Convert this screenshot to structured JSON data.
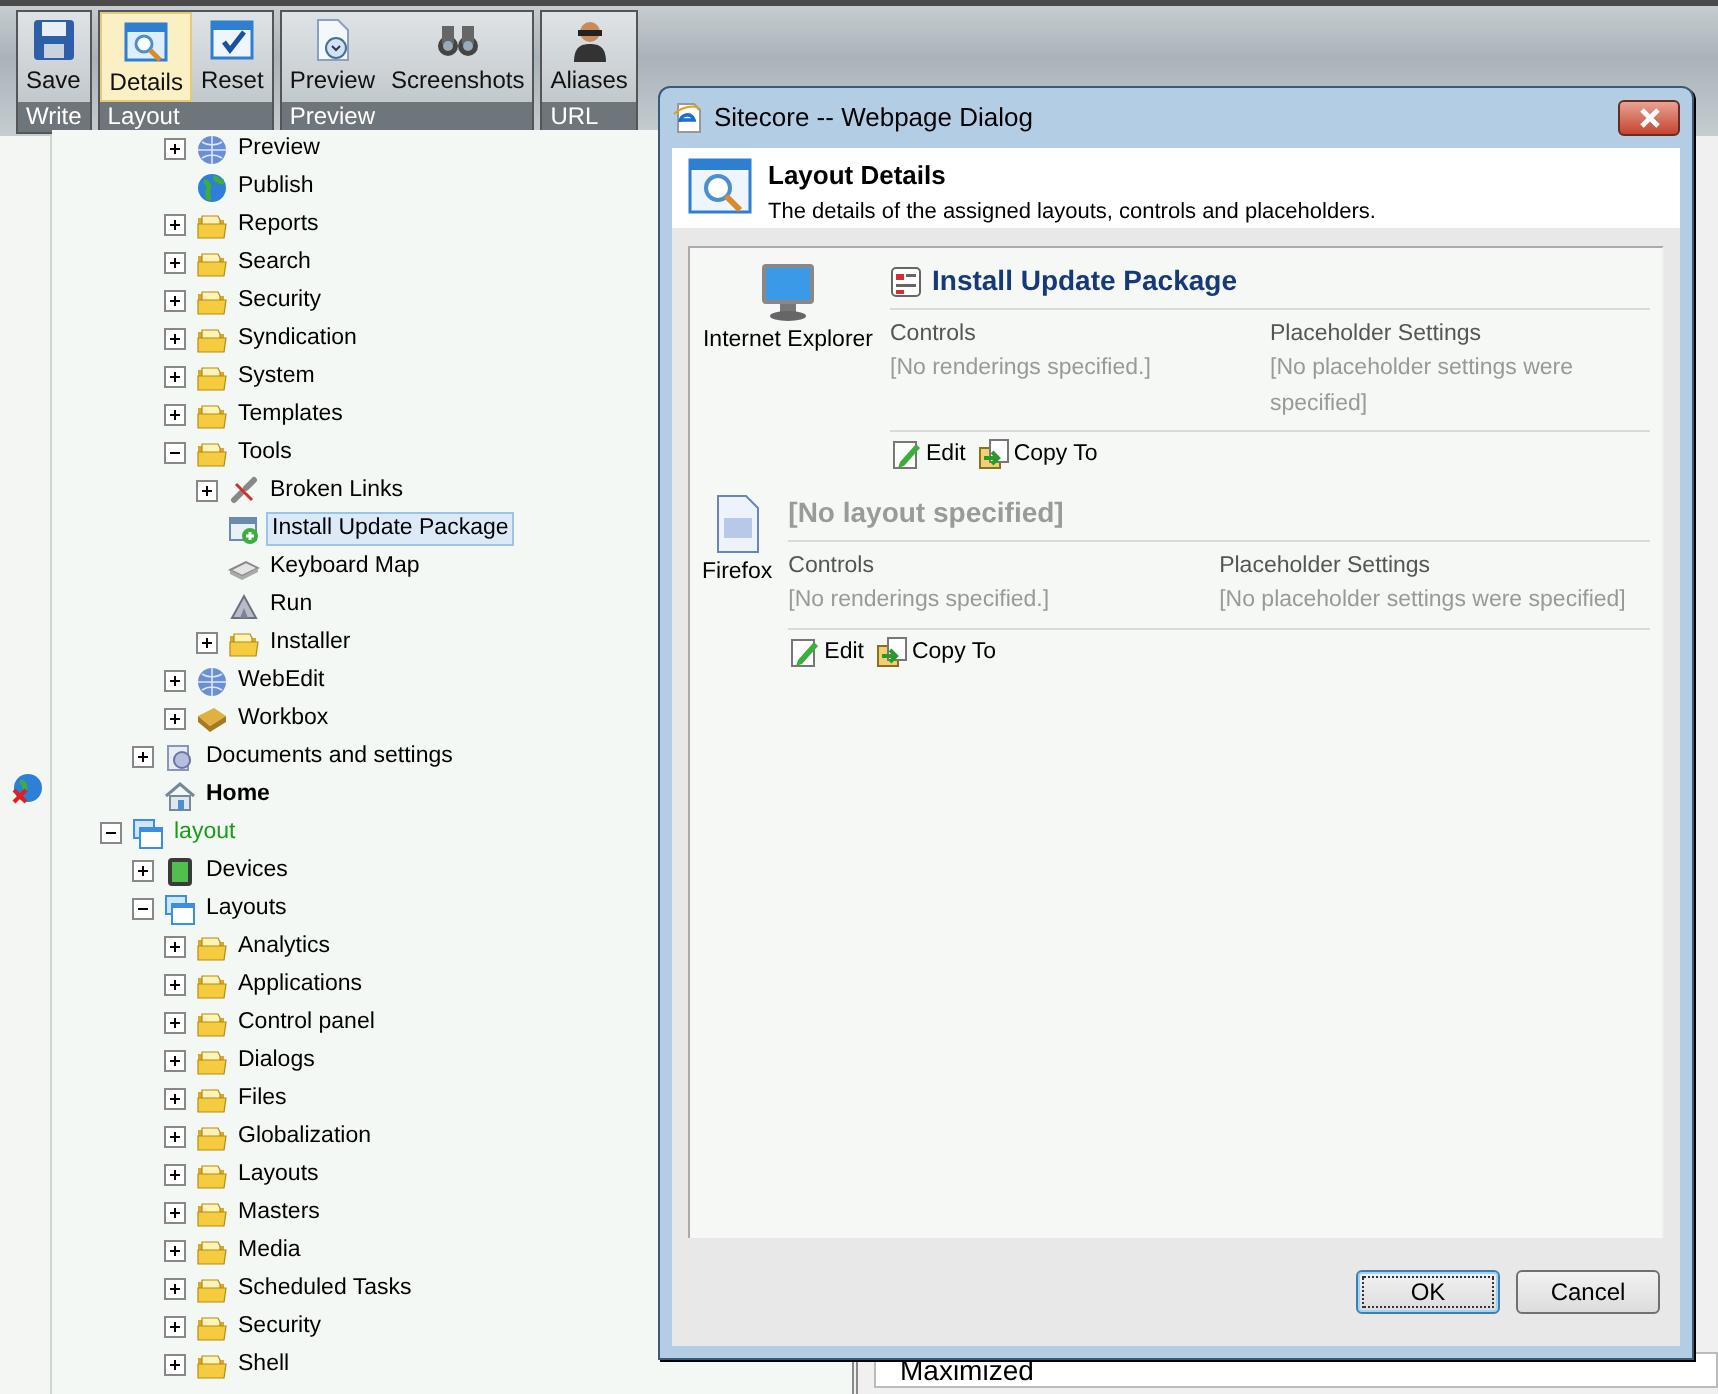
{
  "ribbon": [
    {
      "label": "Write",
      "buttons": [
        {
          "label": "Save",
          "kind": "save",
          "selected": false
        }
      ]
    },
    {
      "label": "Layout",
      "buttons": [
        {
          "label": "Details",
          "kind": "details",
          "selected": true
        },
        {
          "label": "Reset",
          "kind": "reset",
          "selected": false
        }
      ]
    },
    {
      "label": "Preview",
      "buttons": [
        {
          "label": "Preview",
          "kind": "preview",
          "selected": false
        },
        {
          "label": "Screenshots",
          "kind": "binoculars",
          "selected": false
        }
      ]
    },
    {
      "label": "URL",
      "buttons": [
        {
          "label": "Aliases",
          "kind": "person",
          "selected": false
        }
      ]
    }
  ],
  "tree": [
    {
      "children": [
        {
          "children": [
            {
              "label": "Preview",
              "kind": "webglobe",
              "expanded": false,
              "selected": false
            },
            {
              "label": "Publish",
              "kind": "globe",
              "selected": false
            },
            {
              "label": "Reports",
              "kind": "folder",
              "expanded": false,
              "selected": false
            },
            {
              "label": "Search",
              "kind": "folder",
              "expanded": false,
              "selected": false
            },
            {
              "label": "Security",
              "kind": "folder",
              "expanded": false,
              "selected": false
            },
            {
              "label": "Syndication",
              "kind": "folder",
              "expanded": false,
              "selected": false
            },
            {
              "label": "System",
              "kind": "folder",
              "expanded": false,
              "selected": false
            },
            {
              "label": "Templates",
              "kind": "folder",
              "expanded": false,
              "selected": false
            },
            {
              "label": "Tools",
              "kind": "folder",
              "expanded": true,
              "selected": false,
              "children": [
                {
                  "label": "Broken Links",
                  "kind": "brokenlink",
                  "expanded": false,
                  "selected": false
                },
                {
                  "label": "Install Update Package",
                  "kind": "package",
                  "selected": true
                },
                {
                  "label": "Keyboard Map",
                  "kind": "keyboard",
                  "selected": false
                },
                {
                  "label": "Run",
                  "kind": "run",
                  "selected": false
                },
                {
                  "label": "Installer",
                  "kind": "folder",
                  "expanded": false,
                  "selected": false
                }
              ]
            },
            {
              "label": "WebEdit",
              "kind": "webglobe",
              "expanded": false,
              "selected": false
            },
            {
              "label": "Workbox",
              "kind": "workbox",
              "expanded": false,
              "selected": false
            }
          ]
        },
        {
          "label": "Documents and settings",
          "kind": "docs",
          "expanded": false,
          "selected": false
        },
        {
          "label": "Home",
          "kind": "home",
          "selected": false,
          "bold": true,
          "flagged": true
        }
      ]
    },
    {
      "label": "layout",
      "kind": "stack",
      "expanded": true,
      "selected": false,
      "highlighted": true,
      "children": [
        {
          "label": "Devices",
          "kind": "device",
          "expanded": false,
          "selected": false
        },
        {
          "label": "Layouts",
          "kind": "stack",
          "expanded": true,
          "selected": false,
          "children": [
            {
              "label": "Analytics",
              "kind": "folder",
              "expanded": false,
              "selected": false
            },
            {
              "label": "Applications",
              "kind": "folder",
              "expanded": false,
              "selected": false
            },
            {
              "label": "Control panel",
              "kind": "folder",
              "expanded": false,
              "selected": false
            },
            {
              "label": "Dialogs",
              "kind": "folder",
              "expanded": false,
              "selected": false
            },
            {
              "label": "Files",
              "kind": "folder",
              "expanded": false,
              "selected": false
            },
            {
              "label": "Globalization",
              "kind": "folder",
              "expanded": false,
              "selected": false
            },
            {
              "label": "Layouts",
              "kind": "folder",
              "expanded": false,
              "selected": false
            },
            {
              "label": "Masters",
              "kind": "folder",
              "expanded": false,
              "selected": false
            },
            {
              "label": "Media",
              "kind": "folder",
              "expanded": false,
              "selected": false
            },
            {
              "label": "Scheduled Tasks",
              "kind": "folder",
              "expanded": false,
              "selected": false
            },
            {
              "label": "Security",
              "kind": "folder",
              "expanded": false,
              "selected": false
            },
            {
              "label": "Shell",
              "kind": "folder",
              "expanded": false,
              "selected": false
            }
          ]
        }
      ]
    }
  ],
  "background_field": {
    "value": "Maximized"
  },
  "dialog": {
    "title": "Sitecore -- Webpage Dialog",
    "header": {
      "title": "Layout Details",
      "subtitle": "The details of the assigned layouts, controls and placeholders."
    },
    "devices": [
      {
        "name": "Internet Explorer",
        "kind": "monitor",
        "layout": "Install Update Package",
        "assigned": true,
        "controls_label": "Controls",
        "controls_value": "[No renderings specified.]",
        "placeholders_label": "Placeholder Settings",
        "placeholders_value": "[No placeholder settings were specified]",
        "actions": [
          {
            "label": "Edit",
            "kind": "edit"
          },
          {
            "label": "Copy To",
            "kind": "copy"
          }
        ]
      },
      {
        "name": "Firefox",
        "kind": "page",
        "layout": "[No layout specified]",
        "assigned": false,
        "controls_label": "Controls",
        "controls_value": "[No renderings specified.]",
        "placeholders_label": "Placeholder Settings",
        "placeholders_value": "[No placeholder settings were specified]",
        "actions": [
          {
            "label": "Edit",
            "kind": "edit"
          },
          {
            "label": "Copy To",
            "kind": "copy"
          }
        ]
      }
    ],
    "buttons": [
      {
        "label": "OK",
        "default": true
      },
      {
        "label": "Cancel",
        "default": false
      }
    ]
  }
}
